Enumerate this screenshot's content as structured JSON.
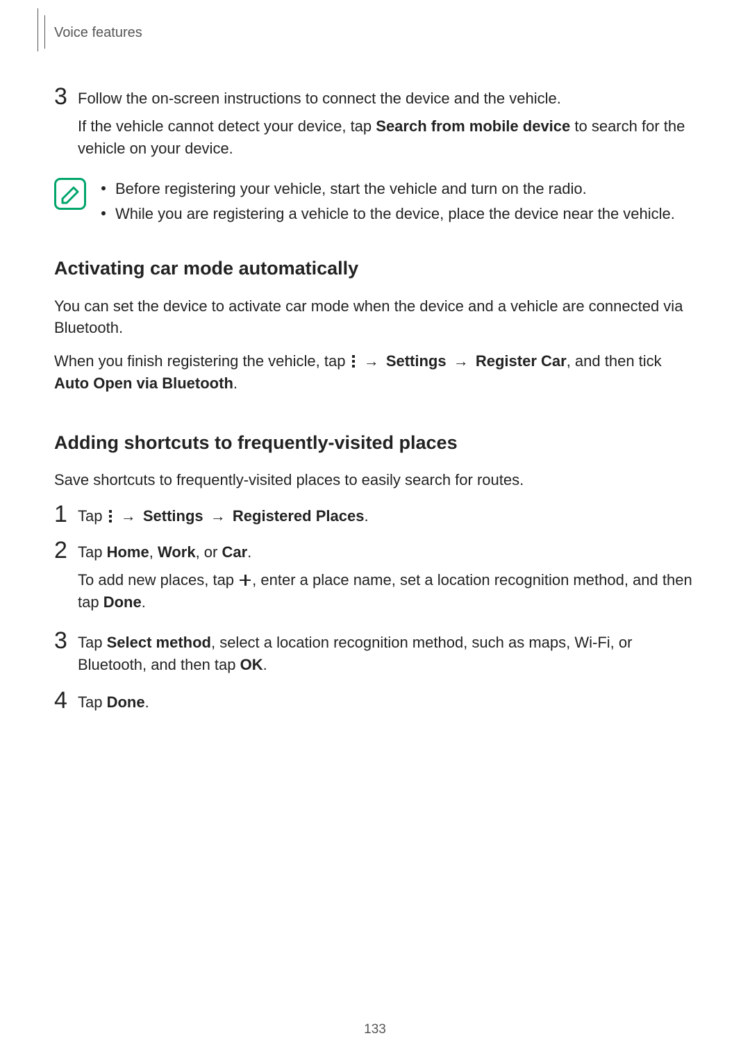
{
  "header": {
    "section": "Voice features"
  },
  "step3_intro": {
    "line1": "Follow the on-screen instructions to connect the device and the vehicle.",
    "line2a": "If the vehicle cannot detect your device, tap ",
    "line2_bold": "Search from mobile device",
    "line2b": " to search for the vehicle on your device."
  },
  "note": {
    "items": [
      "Before registering your vehicle, start the vehicle and turn on the radio.",
      "While you are registering a vehicle to the device, place the device near the vehicle."
    ]
  },
  "sectionA": {
    "heading": "Activating car mode automatically",
    "p1": "You can set the device to activate car mode when the device and a vehicle are connected via Bluetooth.",
    "p2a": "When you finish registering the vehicle, tap ",
    "p2_settings": "Settings",
    "p2_register": "Register Car",
    "p2b": ", and then tick ",
    "p2_bold": "Auto Open via Bluetooth",
    "p2c": "."
  },
  "sectionB": {
    "heading": "Adding shortcuts to frequently-visited places",
    "p1": "Save shortcuts to frequently-visited places to easily search for routes.",
    "step1": {
      "pre": "Tap ",
      "settings": "Settings",
      "places": "Registered Places",
      "end": "."
    },
    "step2": {
      "pre": "Tap ",
      "home": "Home",
      "work": "Work",
      "or": ", or ",
      "car": "Car",
      "end": ".",
      "sub_pre": "To add new places, tap ",
      "sub_mid": ", enter a place name, set a location recognition method, and then tap ",
      "done": "Done",
      "sub_end": "."
    },
    "step3": {
      "pre": "Tap ",
      "select": "Select method",
      "mid": ", select a location recognition method, such as maps, Wi-Fi, or Bluetooth, and then tap ",
      "ok": "OK",
      "end": "."
    },
    "step4": {
      "pre": "Tap ",
      "done": "Done",
      "end": "."
    }
  },
  "glyphs": {
    "arrow": "→"
  },
  "page_number": "133"
}
